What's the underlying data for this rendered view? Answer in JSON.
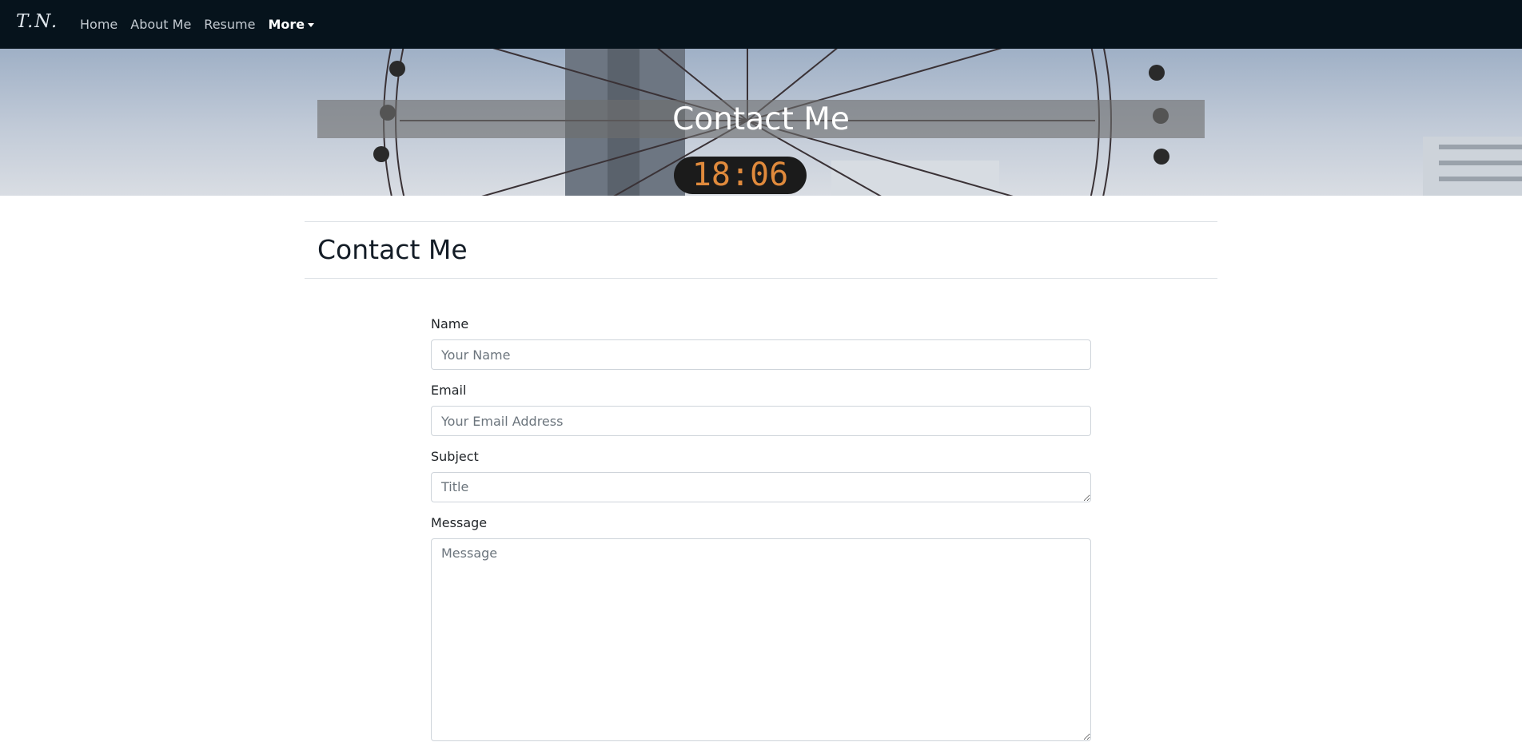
{
  "nav": {
    "brand": "T.N.",
    "links": [
      "Home",
      "About Me",
      "Resume"
    ],
    "more": "More"
  },
  "hero": {
    "title": "Contact Me",
    "clock": "18:06"
  },
  "page": {
    "heading": "Contact Me"
  },
  "form": {
    "name_label": "Name",
    "name_placeholder": "Your Name",
    "email_label": "Email",
    "email_placeholder": "Your Email Address",
    "subject_label": "Subject",
    "subject_placeholder": "Title",
    "message_label": "Message",
    "message_placeholder": "Message"
  },
  "colors": {
    "navbar": "#06131c",
    "heading": "#131c26",
    "clock": "#e08a3c"
  }
}
